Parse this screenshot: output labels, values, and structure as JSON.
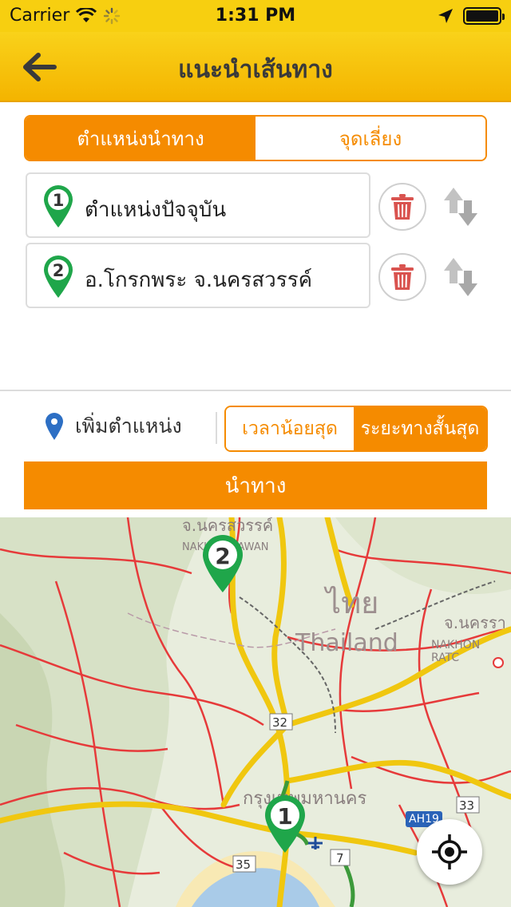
{
  "status_bar": {
    "carrier": "Carrier",
    "time": "1:31 PM",
    "icons": [
      "wifi-icon",
      "activity-spinner-icon",
      "location-arrow-icon",
      "battery-icon"
    ]
  },
  "nav": {
    "title": "แนะนำเส้นทาง",
    "back_icon": "arrow-left-icon"
  },
  "tabs": [
    {
      "label": "ตำแหน่งนำทาง",
      "active": true
    },
    {
      "label": "จุดเลี่ยง",
      "active": false
    }
  ],
  "waypoints": [
    {
      "number": "1",
      "label": "ตำแหน่งปัจจุบัน"
    },
    {
      "number": "2",
      "label": "อ.โกรกพระ  จ.นครสวรรค์"
    }
  ],
  "add_location": {
    "label": "เพิ่มตำแหน่ง",
    "icon": "map-pin-icon"
  },
  "route_options": [
    {
      "label": "เวลาน้อยสุด",
      "active": false
    },
    {
      "label": "ระยะทางสั้นสุด",
      "active": true
    }
  ],
  "navigate_button": "นำทาง",
  "map": {
    "labels": {
      "thai_country": "ไทย",
      "country": "Thailand",
      "nakhon_sawan_th": "จ.นครสวรรค์",
      "nakhon_sawan_en": "NAKHON SAWAN",
      "nakhon_rat_th": "จ.นครรา",
      "nakhon_rat_en": "NAKHON RATC",
      "bangkok_th": "กรุงเทพมหานคร",
      "route_32": "32",
      "route_35": "35",
      "route_7": "7",
      "route_33": "33",
      "route_ah19": "AH19"
    },
    "pins": [
      "1",
      "2"
    ]
  },
  "colors": {
    "accent": "#f58b00",
    "header": "#f7cf10",
    "pin_green": "#1fa64a",
    "trash_red": "#d9534f"
  }
}
